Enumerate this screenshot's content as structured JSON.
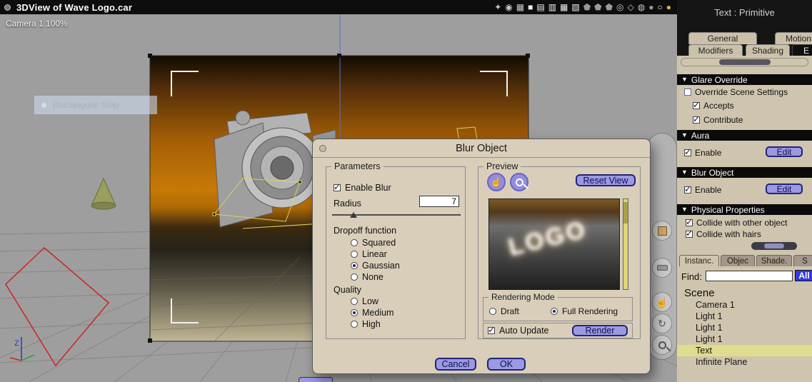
{
  "window": {
    "title": "3DView of Wave Logo.car",
    "camera_label": "Camera 1 100%"
  },
  "viewport": {
    "axis_label": "Z"
  },
  "snip_overlay": {
    "label": "Rectangular Snip"
  },
  "toolbar": {
    "icons": [
      {
        "name": "wand-icon",
        "glyph": "✦"
      },
      {
        "name": "camera-icon",
        "glyph": "◉"
      },
      {
        "name": "scene-preview-icon",
        "glyph": "▦"
      },
      {
        "name": "layout-single-icon",
        "glyph": "■"
      },
      {
        "name": "layout-rows-icon",
        "glyph": "▤"
      },
      {
        "name": "layout-columns-icon",
        "glyph": "▥"
      },
      {
        "name": "layout-grid-icon",
        "glyph": "▦"
      },
      {
        "name": "layout-quad-icon",
        "glyph": "▧"
      },
      {
        "name": "shield-wire-icon",
        "glyph": "⬟"
      },
      {
        "name": "shield-flat-icon",
        "glyph": "⬟"
      },
      {
        "name": "shield-shaded-icon",
        "glyph": "⬟"
      },
      {
        "name": "orbit-icon",
        "glyph": "◎"
      },
      {
        "name": "diamond-icon",
        "glyph": "◇"
      },
      {
        "name": "wire-sphere-icon",
        "glyph": "◍"
      },
      {
        "name": "shaded-sphere-icon",
        "glyph": "●"
      },
      {
        "name": "white-sphere-icon",
        "glyph": "○"
      },
      {
        "name": "gold-sphere-icon",
        "glyph": "●"
      }
    ]
  },
  "dialog": {
    "title": "Blur Object",
    "parameters": {
      "group_label": "Parameters",
      "enable_blur": "Enable Blur",
      "radius_label": "Radius",
      "radius_value": "7",
      "dropoff_label": "Dropoff function",
      "dropoff_options": [
        "Squared",
        "Linear",
        "Gaussian",
        "None"
      ],
      "dropoff_selected": "Gaussian",
      "quality_label": "Quality",
      "quality_options": [
        "Low",
        "Medium",
        "High"
      ],
      "quality_selected": "Medium"
    },
    "preview": {
      "group_label": "Preview",
      "reset_view": "Reset View",
      "logo_text": "LOGO",
      "rendering_mode_label": "Rendering Mode",
      "rendering_options": [
        "Draft",
        "Full Rendering"
      ],
      "rendering_selected": "Full Rendering",
      "auto_update": "Auto Update",
      "render_button": "Render"
    },
    "cancel": "Cancel",
    "ok": "OK"
  },
  "right_panel": {
    "title": "Text : Primitive",
    "tabs_row1": [
      "General",
      "Motion"
    ],
    "tabs_row2": [
      "Modifiers",
      "Shading",
      "E"
    ],
    "sections": [
      {
        "title": "Glare Override",
        "items": [
          {
            "label": "Override Scene Settings",
            "checked": false
          },
          {
            "label": "Accepts",
            "checked": true
          },
          {
            "label": "Contribute",
            "checked": true
          }
        ]
      },
      {
        "title": "Aura",
        "items": [
          {
            "label": "Enable",
            "checked": true,
            "button": "Edit"
          }
        ]
      },
      {
        "title": "Blur Object",
        "items": [
          {
            "label": "Enable",
            "checked": true,
            "button": "Edit"
          }
        ]
      },
      {
        "title": "Physical Properties",
        "items": [
          {
            "label": "Collide with other object",
            "checked": true
          },
          {
            "label": "Collide with hairs",
            "checked": true
          }
        ]
      }
    ],
    "lower_tabs": [
      "Instanc.",
      "Objec",
      "Shade.",
      "S"
    ],
    "find_label": "Find:",
    "all_button": "All",
    "scene_label": "Scene",
    "scene_items": [
      "Camera 1",
      "Light 1",
      "Light 1",
      "Light 1",
      "Text",
      "Infinite Plane"
    ]
  },
  "colors": {
    "accent_button": "#9a99e2",
    "panel_bg": "#cfc5ae",
    "titlebar_bg": "#0d0d0d",
    "backdrop_orange": "#c77907",
    "scene_highlight": "#e0dc8e",
    "all_button_blue": "#2f3bdd"
  }
}
